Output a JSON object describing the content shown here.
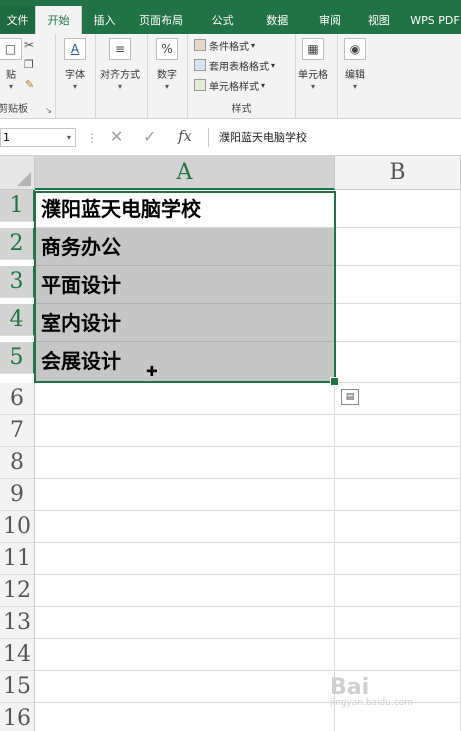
{
  "ribbon_tabs": {
    "file": "文件",
    "active": "开始",
    "others": [
      "插入",
      "页面布局",
      "公式",
      "数据",
      "审阅",
      "视图",
      "WPS PDF"
    ]
  },
  "ribbon": {
    "clipboard": {
      "paste": "贴",
      "label": "剪贴板"
    },
    "font": {
      "label": "字体"
    },
    "alignment": {
      "label": "对齐方式"
    },
    "number": {
      "label": "数字"
    },
    "styles": {
      "conditional": "条件格式",
      "table_format": "套用表格格式",
      "cell_styles": "单元格样式",
      "label": "样式"
    },
    "cells": {
      "label": "单元格"
    },
    "editing": {
      "label": "编辑"
    }
  },
  "formula_bar": {
    "name_box": "1",
    "content": "濮阳蓝天电脑学校"
  },
  "columns": [
    "A",
    "B"
  ],
  "rows": [
    "1",
    "2",
    "3",
    "4",
    "5",
    "6",
    "7",
    "8",
    "9",
    "10",
    "11",
    "12",
    "13",
    "14",
    "15",
    "16"
  ],
  "cells": {
    "A1": "濮阳蓝天电脑学校",
    "A2": "商务办公",
    "A3": "平面设计",
    "A4": "室内设计",
    "A5": "会展设计"
  },
  "watermark": {
    "text": "Bai",
    "sub": "jingyan.baidu.com"
  },
  "colors": {
    "accent": "#217346",
    "selection": "#c6c6c6"
  },
  "icons": [
    "cut-icon",
    "copy-icon",
    "format-painter-icon",
    "font-icon",
    "align-icon",
    "percent-icon",
    "cells-icon",
    "find-icon",
    "cancel-icon",
    "check-icon",
    "fx-icon",
    "quick-analysis-icon"
  ]
}
